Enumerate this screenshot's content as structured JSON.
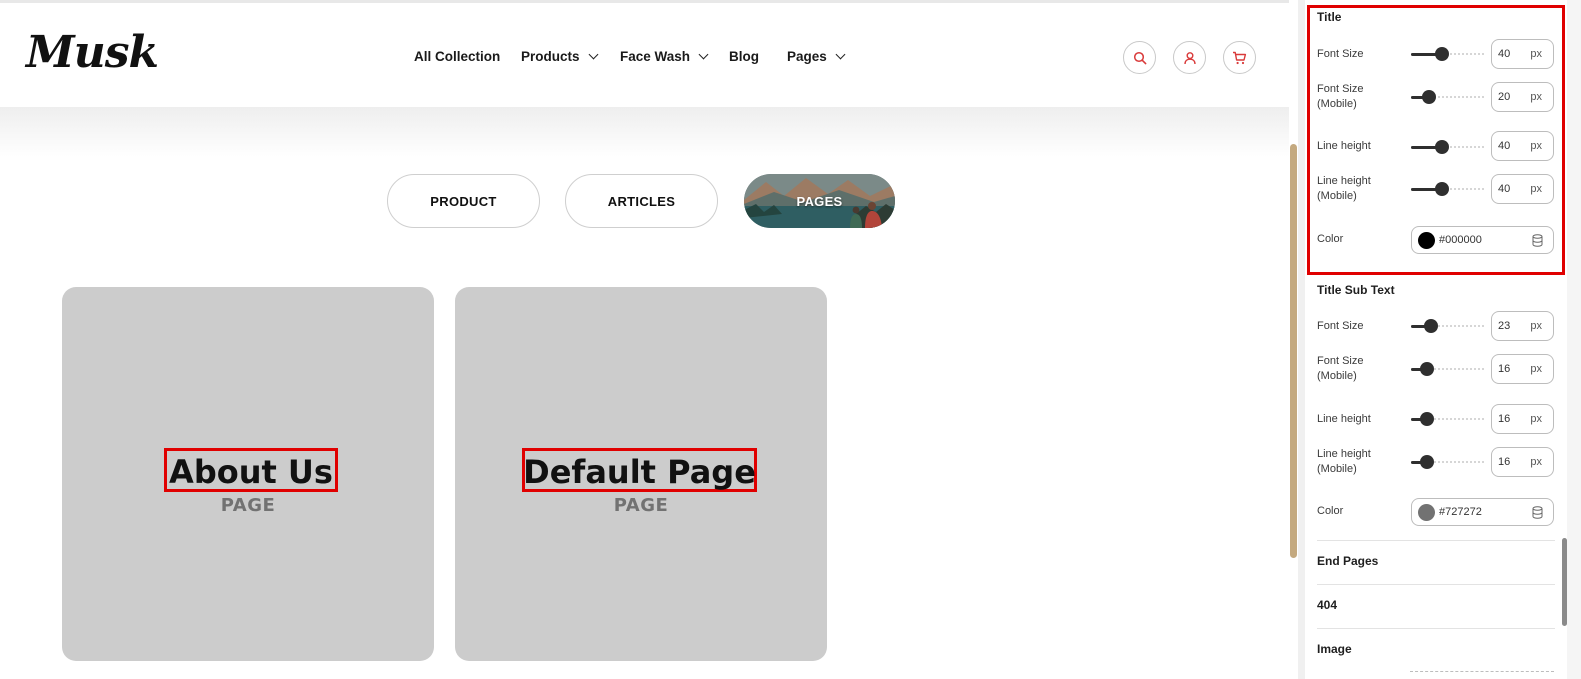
{
  "header": {
    "logo": "Musk",
    "nav": [
      {
        "label": "All Collection",
        "dropdown": false
      },
      {
        "label": "Products",
        "dropdown": true
      },
      {
        "label": "Face Wash",
        "dropdown": true
      },
      {
        "label": "Blog",
        "dropdown": false
      },
      {
        "label": "Pages",
        "dropdown": true
      }
    ],
    "icons": [
      "search-icon",
      "user-icon",
      "cart-icon"
    ],
    "icon_color": "#d93a3a"
  },
  "tabs": [
    {
      "label": "PRODUCT",
      "active": false
    },
    {
      "label": "ARTICLES",
      "active": false
    },
    {
      "label": "PAGES",
      "active": true
    }
  ],
  "cards": [
    {
      "title": "About Us",
      "subtitle": "PAGE"
    },
    {
      "title": "Default Page",
      "subtitle": "PAGE"
    }
  ],
  "panel": {
    "title_section": {
      "heading": "Title",
      "font_size": {
        "label": "Font Size",
        "value": "40",
        "unit": "px",
        "level": 0.42
      },
      "font_size_mobile": {
        "label": "Font Size (Mobile)",
        "value": "20",
        "unit": "px",
        "level": 0.25
      },
      "line_height": {
        "label": "Line height",
        "value": "40",
        "unit": "px",
        "level": 0.42
      },
      "line_height_mobile": {
        "label": "Line height (Mobile)",
        "value": "40",
        "unit": "px",
        "level": 0.42
      },
      "color": {
        "label": "Color",
        "hex": "#000000"
      }
    },
    "subtext_section": {
      "heading": "Title Sub Text",
      "font_size": {
        "label": "Font Size",
        "value": "23",
        "unit": "px",
        "level": 0.28
      },
      "font_size_mobile": {
        "label": "Font Size (Mobile)",
        "value": "16",
        "unit": "px",
        "level": 0.22
      },
      "line_height": {
        "label": "Line height",
        "value": "16",
        "unit": "px",
        "level": 0.22
      },
      "line_height_mobile": {
        "label": "Line height (Mobile)",
        "value": "16",
        "unit": "px",
        "level": 0.22
      },
      "color": {
        "label": "Color",
        "hex": "#727272"
      }
    },
    "end_pages": "End Pages",
    "item_404": "404",
    "image": "Image"
  }
}
